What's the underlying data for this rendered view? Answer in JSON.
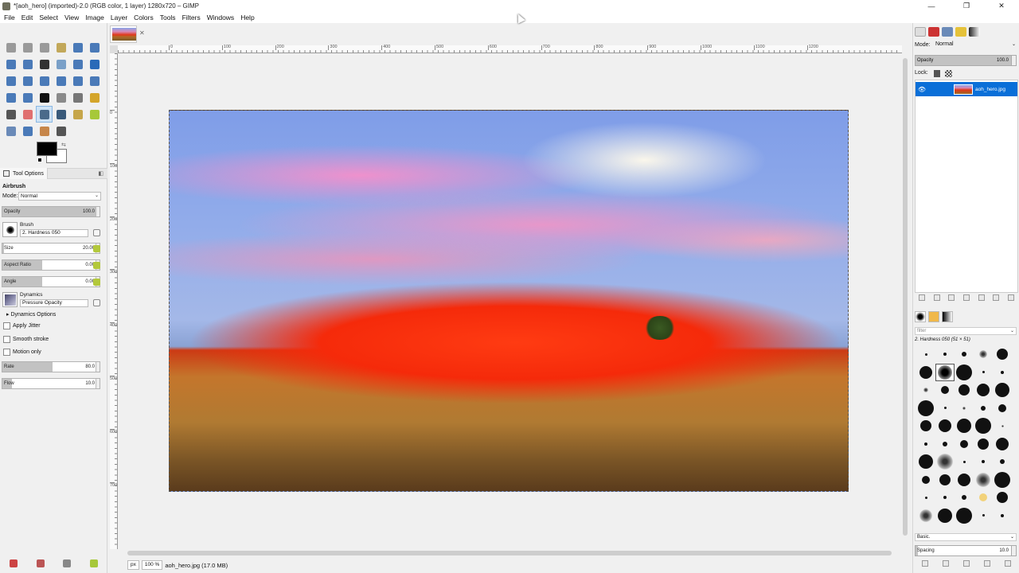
{
  "window": {
    "title": "*[aoh_hero] (imported)-2.0 (RGB color, 1 layer) 1280x720 – GIMP",
    "controls": [
      "—",
      "❐",
      "✕"
    ]
  },
  "menu": [
    "File",
    "Edit",
    "Select",
    "View",
    "Image",
    "Layer",
    "Colors",
    "Tools",
    "Filters",
    "Windows",
    "Help"
  ],
  "toolbox": {
    "tools": [
      {
        "icon": "rect-select-icon",
        "color": "#9a9a9a"
      },
      {
        "icon": "ellipse-select-icon",
        "color": "#9a9a9a"
      },
      {
        "icon": "free-select-icon",
        "color": "#9a9a9a"
      },
      {
        "icon": "fuzzy-select-icon",
        "color": "#c2a85a"
      },
      {
        "icon": "color-select-icon",
        "color": "#4a7ab8"
      },
      {
        "icon": "scissors-icon",
        "color": "#4a7ab8"
      },
      {
        "icon": "foreground-select-icon",
        "color": "#4a7ab8"
      },
      {
        "icon": "paths-icon",
        "color": "#4a7ab8"
      },
      {
        "icon": "color-picker-icon",
        "color": "#333333"
      },
      {
        "icon": "zoom-icon",
        "color": "#7aa0c8"
      },
      {
        "icon": "measure-icon",
        "color": "#4a7ab8"
      },
      {
        "icon": "move-icon",
        "color": "#2a6ab8"
      },
      {
        "icon": "align-icon",
        "color": "#4a7ab8"
      },
      {
        "icon": "crop-icon",
        "color": "#4a7ab8"
      },
      {
        "icon": "rotate-icon",
        "color": "#4a7ab8"
      },
      {
        "icon": "scale-icon",
        "color": "#4a7ab8"
      },
      {
        "icon": "shear-icon",
        "color": "#4a7ab8"
      },
      {
        "icon": "perspective-icon",
        "color": "#4a7ab8"
      },
      {
        "icon": "flip-icon",
        "color": "#4a7ab8"
      },
      {
        "icon": "cage-icon",
        "color": "#4a7ab8"
      },
      {
        "icon": "text-icon",
        "color": "#111111"
      },
      {
        "icon": "bucket-fill-icon",
        "color": "#8a8a8a"
      },
      {
        "icon": "gradient-icon",
        "color": "#777777"
      },
      {
        "icon": "pencil-icon",
        "color": "#d4a52a"
      },
      {
        "icon": "paintbrush-icon",
        "color": "#555555"
      },
      {
        "icon": "eraser-icon",
        "color": "#e07070"
      },
      {
        "icon": "airbrush-icon",
        "color": "#4a6a8a"
      },
      {
        "icon": "ink-icon",
        "color": "#3a5a7a"
      },
      {
        "icon": "mypaint-brush-icon",
        "color": "#c6a64a"
      },
      {
        "icon": "clone-icon",
        "color": "#a6c83a"
      },
      {
        "icon": "heal-icon",
        "color": "#6a8ab8"
      },
      {
        "icon": "blur-icon",
        "color": "#4a7ab8"
      },
      {
        "icon": "smudge-icon",
        "color": "#c6864a"
      },
      {
        "icon": "dodge-icon",
        "color": "#555555"
      }
    ],
    "active_tool_index": 26
  },
  "colors": {
    "fg": "#000000",
    "bg": "#ffffff"
  },
  "tool_options": {
    "tab_label": "Tool Options",
    "tool_name": "Airbrush",
    "mode_label": "Mode:",
    "mode_value": "Normal",
    "opacity": {
      "label": "Opacity",
      "value": "100.0",
      "fraction": 1.0
    },
    "brush_label": "Brush",
    "brush_value": "2. Hardness 050",
    "size": {
      "label": "Size",
      "value": "20.00",
      "fraction": 0.02
    },
    "aspect": {
      "label": "Aspect Ratio",
      "value": "0.00",
      "fraction": 0.41
    },
    "angle": {
      "label": "Angle",
      "value": "0.00",
      "fraction": 0.41
    },
    "dynamics_label": "Dynamics",
    "dynamics_value": "Pressure Opacity",
    "dynamics_options": "Dynamics Options",
    "apply_jitter": "Apply Jitter",
    "smooth_stroke": "Smooth stroke",
    "motion_only": "Motion only",
    "rate": {
      "label": "Rate",
      "value": "80.0",
      "fraction": 0.52
    },
    "flow": {
      "label": "Flow",
      "value": "10.0",
      "fraction": 0.1
    }
  },
  "canvas": {
    "image_tab_close": "✕",
    "ruler_h": [
      "0",
      "100",
      "200",
      "300",
      "400",
      "500",
      "600",
      "700",
      "800",
      "900",
      "1000",
      "1100",
      "1200"
    ],
    "ruler_v": [
      "0",
      "100",
      "200",
      "300",
      "400",
      "500",
      "600",
      "700"
    ],
    "unit": "px",
    "zoom": "100 %",
    "status_text": "aoh_hero.jpg (17.0 MB)"
  },
  "layers": {
    "mode_label": "Mode:",
    "mode_value": "Normal",
    "opacity_label": "Opacity",
    "opacity_value": "100.0",
    "lock_label": "Lock:",
    "layer_name": "aoh_hero.jpg"
  },
  "brushes": {
    "filter_placeholder": "filter",
    "selected_name": "2. Hardness 050 (51 × 51)",
    "set_value": "Basic.",
    "spacing_label": "Spacing",
    "spacing_value": "10.0"
  }
}
